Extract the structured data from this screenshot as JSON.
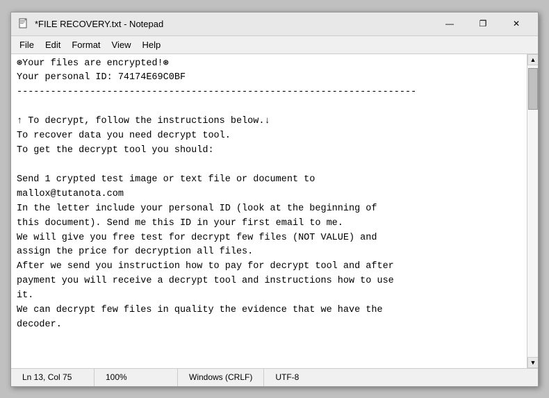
{
  "window": {
    "title": "*FILE RECOVERY.txt - Notepad",
    "icon": "notepad"
  },
  "menu": {
    "items": [
      "File",
      "Edit",
      "Format",
      "View",
      "Help"
    ]
  },
  "editor": {
    "content": "⊛Your files are encrypted!⊛\nYour personal ID: 74174E69C0BF\n-----------------------------------------------------------------------\n\n↑ To decrypt, follow the instructions below.↓\nTo recover data you need decrypt tool.\nTo get the decrypt tool you should:\n\nSend 1 crypted test image or text file or document to\nmallox@tutanota.com\nIn the letter include your personal ID (look at the beginning of\nthis document). Send me this ID in your first email to me.\nWe will give you free test for decrypt few files (NOT VALUE) and\nassign the price for decryption all files.\nAfter we send you instruction how to pay for decrypt tool and after\npayment you will receive a decrypt tool and instructions how to use\nit.\nWe can decrypt few files in quality the evidence that we have the\ndecoder."
  },
  "statusbar": {
    "ln_col": "Ln 13, Col 75",
    "zoom": "100%",
    "line_ending": "Windows (CRLF)",
    "encoding": "UTF-8"
  },
  "buttons": {
    "minimize": "—",
    "maximize": "❐",
    "close": "✕"
  }
}
